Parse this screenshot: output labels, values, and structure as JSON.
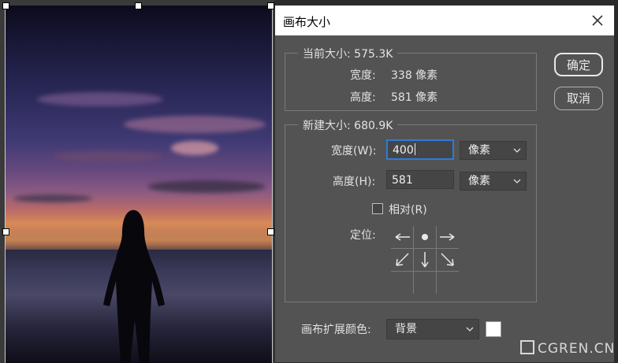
{
  "dialog": {
    "title": "画布大小",
    "current_size": {
      "legend": "当前大小: 575.3K",
      "width_label": "宽度:",
      "width_value": "338 像素",
      "height_label": "高度:",
      "height_value": "581 像素"
    },
    "new_size": {
      "legend": "新建大小: 680.9K",
      "width_label": "宽度(W):",
      "width_value": "400",
      "width_unit": "像素",
      "height_label": "高度(H):",
      "height_value": "581",
      "height_unit": "像素",
      "relative_label": "相对(R)",
      "anchor_label": "定位:"
    },
    "extension_color_label": "画布扩展颜色:",
    "extension_color_value": "背景",
    "swatch_color": "#ffffff",
    "buttons": {
      "ok": "确定",
      "cancel": "取消"
    }
  },
  "watermark": {
    "text": "CGREN.CN"
  },
  "colors": {
    "dialog_bg": "#535353",
    "focus": "#2e7bd6",
    "titlebar": "#ffffff"
  }
}
